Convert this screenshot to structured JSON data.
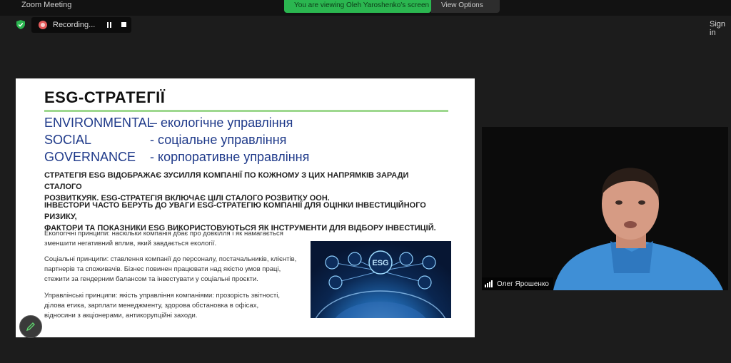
{
  "window": {
    "title": "Zoom Meeting",
    "sign_in": "Sign in"
  },
  "banners": {
    "green_text": "You are viewing Oleh Yaroshenko's screen",
    "view_options": "View Options"
  },
  "recording": {
    "label": "Recording..."
  },
  "slide": {
    "title": "ESG-СТРАТЕГІЇ",
    "environmental": {
      "key": "ENVIRONMENTAL",
      "value": "– екологічне управління"
    },
    "social": {
      "key": "SOCIAL",
      "value": "- соціальне управління"
    },
    "governance": {
      "key": "GOVERNANCE",
      "value": "- корпоративне управління"
    },
    "para1_line1": "Стратегія ESG відображає зусилля компанії по кожному з цих напрямків заради сталого",
    "para1_line2": "розвиткуяк. ESG-стратегія включає цілі сталого розвитку ООН.",
    "para2_line1": "Інвестори часто беруть до уваги ESG-стратегію компанії для оцінки інвестиційного ризику,",
    "para2_line2": "фактори та показники ESG використовуються як інструменти для відбору інвестицій.",
    "env_p1": "Екологічні принципи: наскільки компанія дбає про довкілля і як намагається",
    "env_p2": "зменшити негативний вплив, який завдається екології.",
    "soc_p1": "Соціальні принципи: ставлення компанії до персоналу, постачальників, клієнтів,",
    "soc_p2": "партнерів та споживачів. Бізнес повинен працювати над якістю умов праці,",
    "soc_p3": "стежити за гендерним балансом та інвестувати у соціальні проєкти.",
    "gov_p1": "Управлінські принципи: якість управління компаніями: прозорість звітності,",
    "gov_p2": "ділова етика, зарплати менеджменту, здорова обстановка в офісах,",
    "gov_p3": "відносини з акціонерами, антикорупційні заходи.",
    "image_label": "ESG"
  },
  "participant": {
    "name": "Олег Ярошенко"
  },
  "colors": {
    "esg_blue": "#1f3a8a",
    "rule_green": "#9ed88f",
    "rec_red": "#e35b5b",
    "zoom_green": "#2bb650"
  }
}
